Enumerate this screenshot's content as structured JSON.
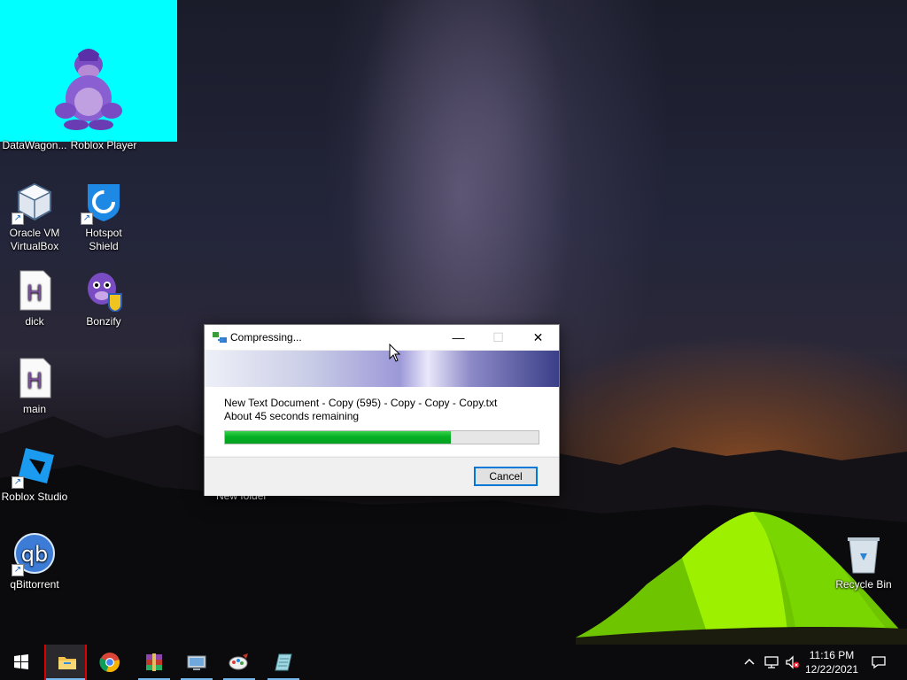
{
  "desktop": {
    "icons": [
      {
        "label": "DataWagon...",
        "icon": "datawagon-icon"
      },
      {
        "label": "Roblox Player",
        "icon": "bonzi-icon"
      },
      {
        "label": "Oracle VM VirtualBox",
        "icon": "virtualbox-icon"
      },
      {
        "label": "Hotspot Shield",
        "icon": "hotspot-shield-icon"
      },
      {
        "label": "dick",
        "icon": "text-file-icon"
      },
      {
        "label": "Bonzify",
        "icon": "bonzify-icon"
      },
      {
        "label": "main",
        "icon": "text-file-icon"
      },
      {
        "label": "Roblox Studio",
        "icon": "roblox-studio-icon"
      },
      {
        "label": "qBittorrent",
        "icon": "qbittorrent-icon"
      },
      {
        "label": "Recycle Bin",
        "icon": "recycle-bin-icon"
      }
    ],
    "partial_label": "New folder"
  },
  "dialog": {
    "title": "Compressing...",
    "filename": "New Text Document - Copy (595) - Copy - Copy - Copy.txt",
    "time_remaining": "About 45 seconds remaining",
    "progress_fraction": 0.72,
    "cancel_label": "Cancel",
    "minimize_glyph": "—",
    "maximize_glyph": "☐",
    "close_glyph": "✕"
  },
  "taskbar": {
    "apps": [
      {
        "name": "start-button",
        "icon": "windows-logo-icon"
      },
      {
        "name": "file-explorer",
        "icon": "folder-icon"
      },
      {
        "name": "chrome",
        "icon": "chrome-icon"
      },
      {
        "name": "winrar",
        "icon": "winrar-icon"
      },
      {
        "name": "remote-desktop",
        "icon": "remote-desktop-icon"
      },
      {
        "name": "paint",
        "icon": "paint-icon"
      },
      {
        "name": "notepad",
        "icon": "notepad-icon"
      }
    ],
    "clock": {
      "time": "11:16 PM",
      "date": "12/22/2021"
    },
    "tray_chevron": "^"
  },
  "colors": {
    "progress_green": "#06b025",
    "cyan_block": "#00ffff",
    "tent_green": "#8ee000",
    "accent_blue": "#0078d7"
  }
}
